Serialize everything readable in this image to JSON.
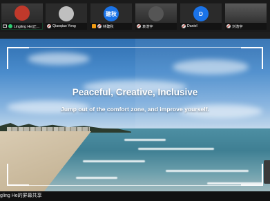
{
  "participants": [
    {
      "name": "Lingling He(正...",
      "avatar_text": "",
      "avatar_color": "#c0392b",
      "mic": "on",
      "active": true
    },
    {
      "name": "Qiaoqiao Yong",
      "avatar_text": "",
      "avatar_color": "#8a8a8a",
      "mic": "muted",
      "active": false
    },
    {
      "name": "林建秋",
      "avatar_text": "建秋",
      "avatar_color": "#1a73e8",
      "mic": "muted",
      "active": false
    },
    {
      "name": "袁浩宇",
      "avatar_text": "",
      "avatar_color": "#555555",
      "mic": "muted",
      "active": false
    },
    {
      "name": "Daniel",
      "avatar_text": "D",
      "avatar_color": "#1a73e8",
      "mic": "muted",
      "active": false
    },
    {
      "name": "刘浩宇",
      "avatar_text": "",
      "avatar_color": "#666666",
      "mic": "muted",
      "active": false
    }
  ],
  "share": {
    "title": "Peaceful, Creative, Inclusive",
    "subtitle": "Jump out of the comfort zone, and improve yourself.",
    "sharer_label": "gling He的屏幕共享"
  }
}
